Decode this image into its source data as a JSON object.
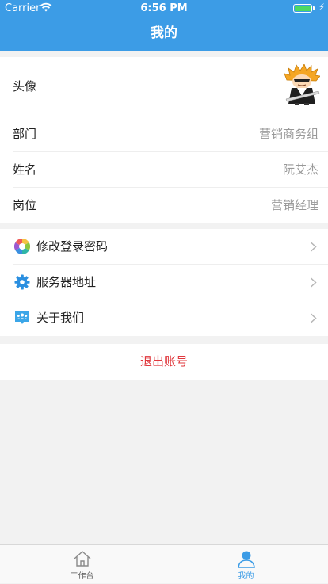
{
  "status_bar": {
    "carrier": "Carrier",
    "time": "6:56 PM"
  },
  "nav": {
    "title": "我的"
  },
  "profile": {
    "avatar_label": "头像",
    "rows": [
      {
        "label": "部门",
        "value": "营销商务组"
      },
      {
        "label": "姓名",
        "value": "阮艾杰"
      },
      {
        "label": "岗位",
        "value": "营销经理"
      }
    ]
  },
  "menu": {
    "items": [
      {
        "label": "修改登录密码",
        "icon": "colorful-pinwheel-icon"
      },
      {
        "label": "服务器地址",
        "icon": "gear-icon"
      },
      {
        "label": "关于我们",
        "icon": "people-chat-icon"
      }
    ]
  },
  "logout_label": "退出账号",
  "tabbar": {
    "tabs": [
      {
        "label": "工作台",
        "icon": "house-icon",
        "active": false
      },
      {
        "label": "我的",
        "icon": "person-icon",
        "active": true
      }
    ]
  },
  "colors": {
    "nav_bg": "#3c9ce6",
    "active_tab": "#3c9ce6",
    "logout": "#e0393e",
    "battery": "#4cd964"
  }
}
